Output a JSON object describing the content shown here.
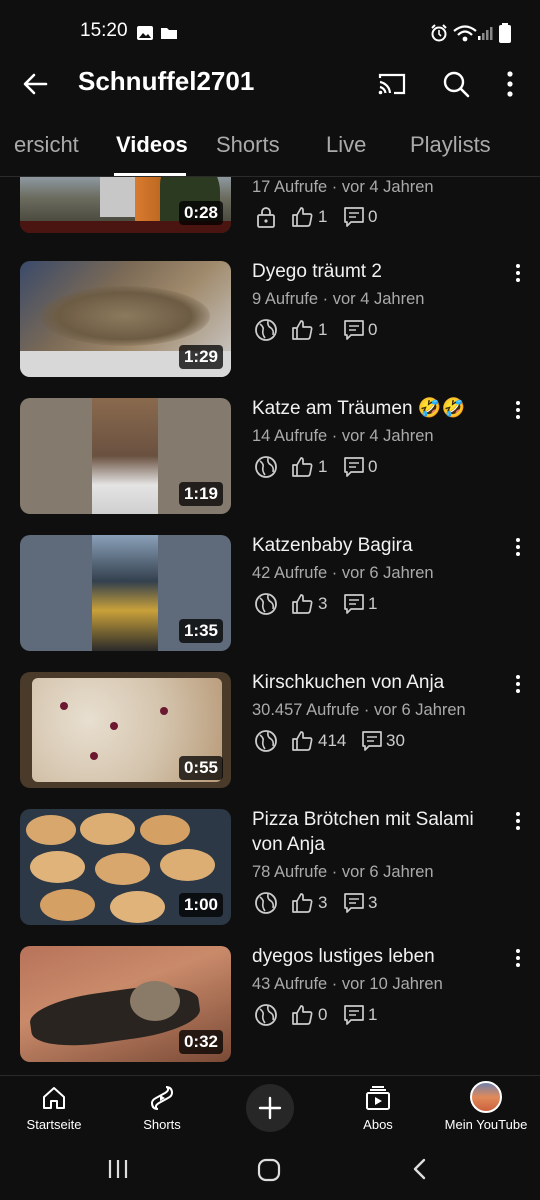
{
  "status_bar": {
    "time": "15:20"
  },
  "header": {
    "title": "Schnuffel2701"
  },
  "tabs": [
    {
      "label": "ersicht"
    },
    {
      "label": "Videos"
    },
    {
      "label": "Shorts"
    },
    {
      "label": "Live"
    },
    {
      "label": "Playlists"
    }
  ],
  "videos": [
    {
      "title": "",
      "meta": "17 Aufrufe · vor 4 Jahren",
      "duration": "0:28",
      "visibility": "lock-icon",
      "likes": "1",
      "comments": "0"
    },
    {
      "title": "Dyego träumt 2",
      "meta": "9 Aufrufe · vor 4 Jahren",
      "duration": "1:29",
      "visibility": "globe-icon",
      "likes": "1",
      "comments": "0"
    },
    {
      "title": "Katze am Träumen 🤣🤣",
      "meta": "14 Aufrufe · vor 4 Jahren",
      "duration": "1:19",
      "visibility": "globe-icon",
      "likes": "1",
      "comments": "0"
    },
    {
      "title": "Katzenbaby Bagira",
      "meta": "42 Aufrufe · vor 6 Jahren",
      "duration": "1:35",
      "visibility": "globe-icon",
      "likes": "3",
      "comments": "1"
    },
    {
      "title": "Kirschkuchen von Anja",
      "meta": "30.457 Aufrufe · vor 6 Jahren",
      "duration": "0:55",
      "visibility": "globe-icon",
      "likes": "414",
      "comments": "30"
    },
    {
      "title": "Pizza Brötchen mit Salami von Anja",
      "meta": "78 Aufrufe · vor 6 Jahren",
      "duration": "1:00",
      "visibility": "globe-icon",
      "likes": "3",
      "comments": "3"
    },
    {
      "title": "dyegos lustiges leben",
      "meta": "43 Aufrufe · vor 10 Jahren",
      "duration": "0:32",
      "visibility": "globe-icon",
      "likes": "0",
      "comments": "1"
    }
  ],
  "bottom_nav": {
    "home": "Startseite",
    "shorts": "Shorts",
    "subs": "Abos",
    "you": "Mein YouTube"
  },
  "colors": {
    "background": "#0f0f0f",
    "text": "#f1f1f1",
    "secondary_text": "#aaaaaa"
  }
}
